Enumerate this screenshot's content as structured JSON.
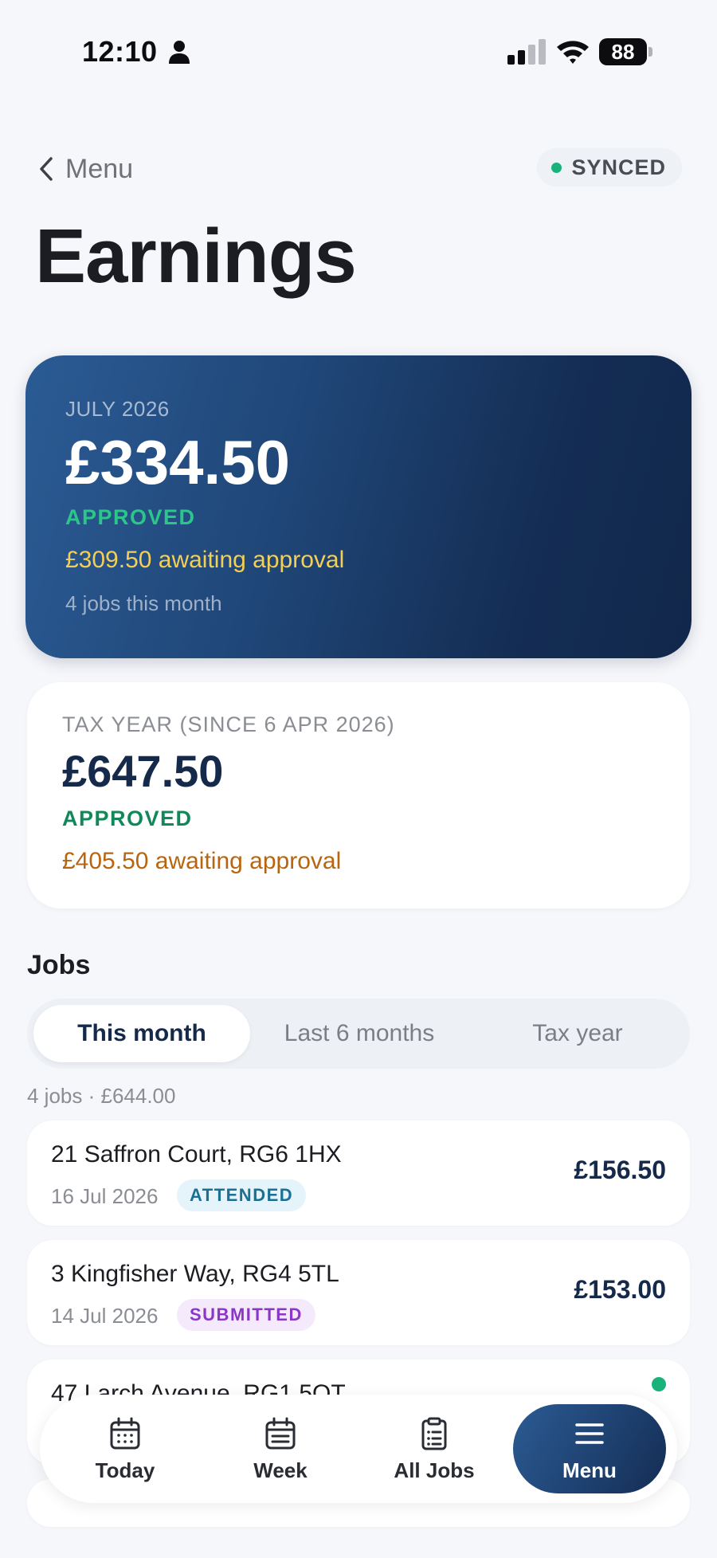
{
  "status_bar": {
    "time": "12:10",
    "battery": "88",
    "battery_percent": 88
  },
  "header": {
    "back_label": "Menu",
    "sync_status": "SYNCED",
    "title": "Earnings"
  },
  "month_card": {
    "period": "JULY 2026",
    "amount": "£334.50",
    "approved_label": "APPROVED",
    "awaiting": "£309.50 awaiting approval",
    "jobs_count": "4 jobs this month"
  },
  "tax_card": {
    "period": "TAX YEAR (SINCE 6 APR 2026)",
    "amount": "£647.50",
    "approved_label": "APPROVED",
    "awaiting": "£405.50 awaiting approval"
  },
  "jobs": {
    "heading": "Jobs",
    "tabs": [
      {
        "label": "This month",
        "active": true
      },
      {
        "label": "Last 6 months",
        "active": false
      },
      {
        "label": "Tax year",
        "active": false
      }
    ],
    "summary": "4 jobs · £644.00",
    "items": [
      {
        "address": "21 Saffron Court, RG6 1HX",
        "date": "16 Jul 2026",
        "status": "ATTENDED",
        "price": "£156.50"
      },
      {
        "address": "3 Kingfisher Way, RG4 5TL",
        "date": "14 Jul 2026",
        "status": "SUBMITTED",
        "price": "£153.00"
      },
      {
        "address": "47 Larch Avenue, RG1 5QT"
      }
    ]
  },
  "bottom_nav": [
    {
      "label": "Today",
      "icon": "calendar-icon"
    },
    {
      "label": "Week",
      "icon": "calendar-week-icon"
    },
    {
      "label": "All Jobs",
      "icon": "clipboard-list-icon"
    },
    {
      "label": "Menu",
      "icon": "hamburger-menu-icon",
      "active": true
    }
  ],
  "colors": {
    "accent_navy": "#142d54",
    "approved_green": "#2cc58a",
    "awaiting_yellow": "#f3cf55",
    "awaiting_orange": "#b8650f",
    "attended": "#1a6f93",
    "submitted": "#8a36c8"
  }
}
